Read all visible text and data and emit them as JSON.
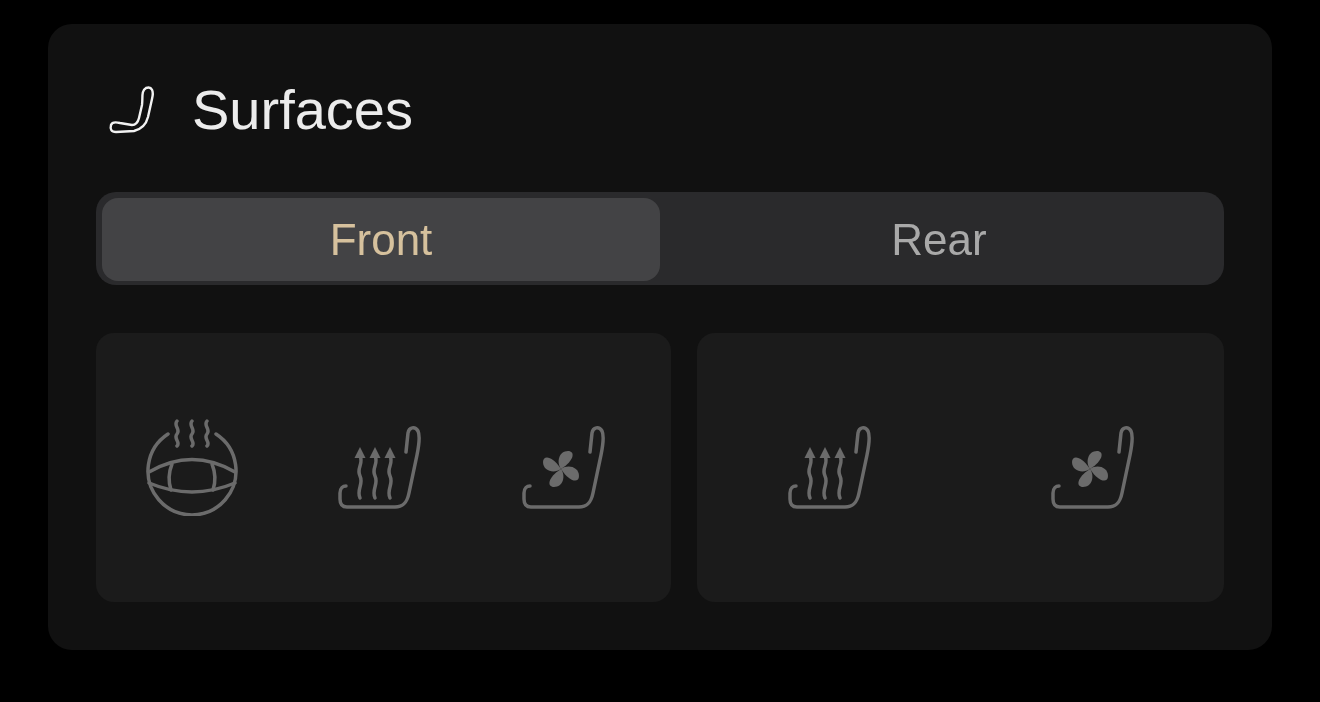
{
  "title": "Surfaces",
  "tabs": [
    {
      "label": "Front",
      "selected": true
    },
    {
      "label": "Rear",
      "selected": false
    }
  ],
  "panels": [
    {
      "controls": [
        {
          "kind": "steering_wheel_heat"
        },
        {
          "kind": "seat_heat"
        },
        {
          "kind": "seat_fan"
        }
      ]
    },
    {
      "controls": [
        {
          "kind": "seat_heat"
        },
        {
          "kind": "seat_fan"
        }
      ]
    }
  ]
}
